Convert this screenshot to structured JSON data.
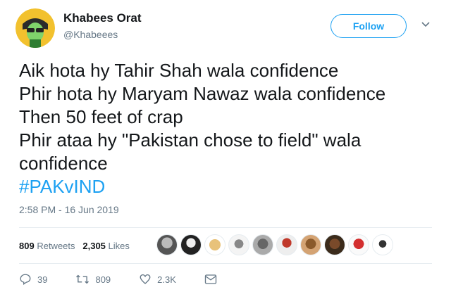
{
  "user": {
    "name": "Khabees Orat",
    "handle": "@Khabeees"
  },
  "follow_label": "Follow",
  "tweet": {
    "lines": [
      "Aik hota hy Tahir Shah wala confidence",
      "Phir hota hy Maryam Nawaz wala confidence",
      "Then 50 feet of crap",
      "Phir ataa hy \"Pakistan chose to field\" wala",
      "confidence"
    ],
    "hashtag": "#PAKvIND",
    "timestamp": "2:58 PM - 16 Jun 2019"
  },
  "stats": {
    "retweets_count": "809",
    "retweets_label": "Retweets",
    "likes_count": "2,305",
    "likes_label": "Likes"
  },
  "likers": [
    "avatar",
    "avatar",
    "avatar",
    "avatar",
    "avatar",
    "avatar",
    "avatar",
    "avatar",
    "avatar",
    "avatar"
  ],
  "actions": {
    "replies": "39",
    "retweets": "809",
    "likes": "2.3K"
  },
  "colors": {
    "accent": "#1da1f2",
    "muted": "#657786",
    "text": "#14171a"
  }
}
